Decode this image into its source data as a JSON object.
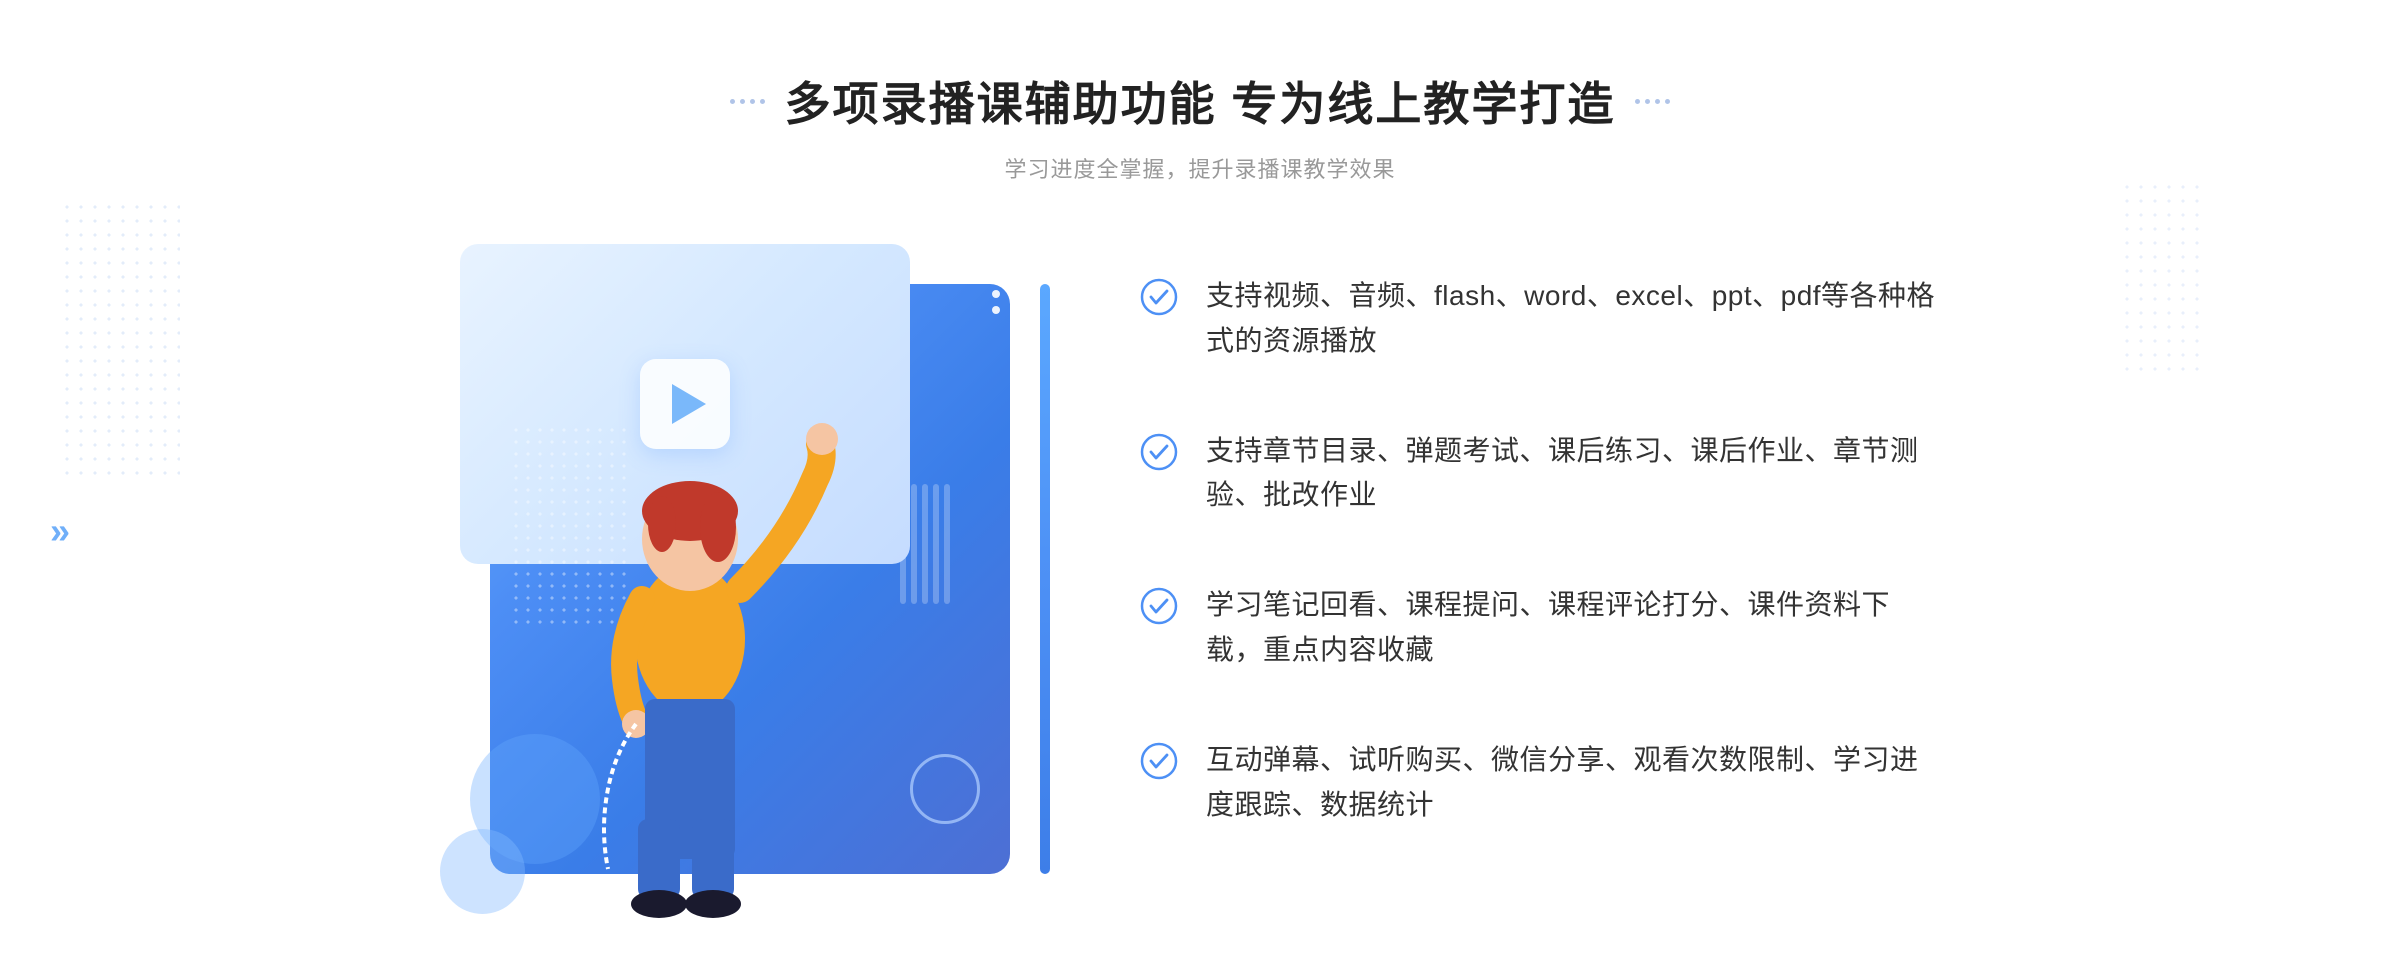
{
  "header": {
    "main_title": "多项录播课辅助功能 专为线上教学打造",
    "subtitle": "学习进度全掌握，提升录播课教学效果"
  },
  "features": [
    {
      "id": 1,
      "text": "支持视频、音频、flash、word、excel、ppt、pdf等各种格式的资源播放"
    },
    {
      "id": 2,
      "text": "支持章节目录、弹题考试、课后练习、课后作业、章节测验、批改作业"
    },
    {
      "id": 3,
      "text": "学习笔记回看、课程提问、课程评论打分、课件资料下载，重点内容收藏"
    },
    {
      "id": 4,
      "text": "互动弹幕、试听购买、微信分享、观看次数限制、学习进度跟踪、数据统计"
    }
  ],
  "decorations": {
    "arrow_left": "»",
    "title_dots_char": "⁞"
  },
  "colors": {
    "accent_blue": "#4d90f5",
    "light_blue": "#6ab0ff",
    "text_dark": "#222222",
    "text_gray": "#999999",
    "text_normal": "#333333"
  }
}
